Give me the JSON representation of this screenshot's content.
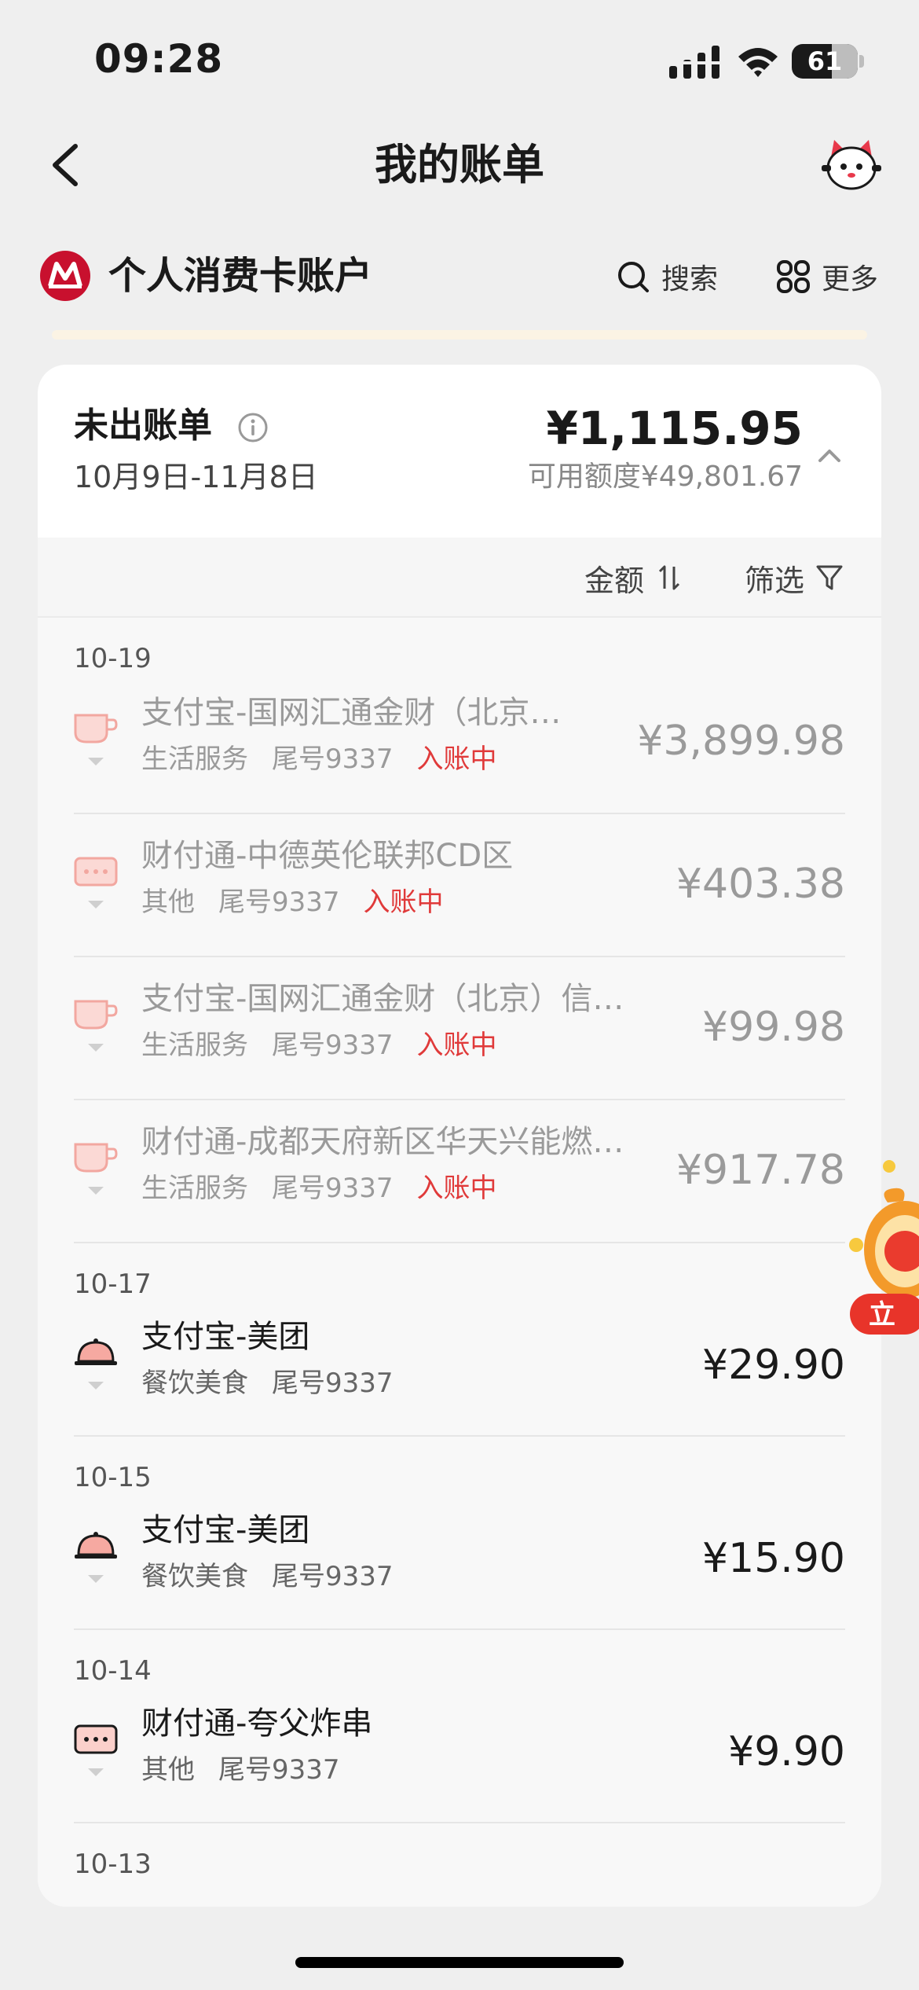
{
  "status_bar": {
    "time": "09:28",
    "battery": "61",
    "battery_level": 0.61,
    "icons": [
      "signal-icon",
      "wifi-icon",
      "battery-icon"
    ]
  },
  "nav": {
    "title": "我的账单",
    "back_icon": "chevron-left-icon",
    "mascot_icon": "cat-mascot-icon"
  },
  "account": {
    "title": "个人消费卡账户",
    "search_label": "搜索",
    "more_label": "更多",
    "brand_color": "#c8102e"
  },
  "bill_summary": {
    "label": "未出账单",
    "period": "10月9日-11月8日",
    "amount": "¥1,115.95",
    "available_credit": "可用额度¥49,801.67"
  },
  "toolbar": {
    "sort_label": "金额",
    "filter_label": "筛选"
  },
  "dates": [
    "10-19",
    "10-17",
    "10-15",
    "10-14",
    "10-13"
  ],
  "transactions": [
    {
      "merchant": "支付宝-国网汇通金财（北京…",
      "category": "生活服务",
      "card": "尾号9337",
      "status": "入账中",
      "amount": "¥3,899.98",
      "icon": "cup-icon"
    },
    {
      "merchant": "财付通-中德英伦联邦CD区",
      "category": "其他",
      "card": "尾号9337",
      "status": "入账中",
      "amount": "¥403.38",
      "icon": "message-dots-icon"
    },
    {
      "merchant": "支付宝-国网汇通金财（北京）信…",
      "category": "生活服务",
      "card": "尾号9337",
      "status": "入账中",
      "amount": "¥99.98",
      "icon": "cup-icon"
    },
    {
      "merchant": "财付通-成都天府新区华天兴能燃…",
      "category": "生活服务",
      "card": "尾号9337",
      "status": "入账中",
      "amount": "¥917.78",
      "icon": "cup-icon"
    },
    {
      "merchant": "支付宝-美团",
      "category": "餐饮美食",
      "card": "尾号9337",
      "status": "",
      "amount": "¥29.90",
      "icon": "food-cloche-icon"
    },
    {
      "merchant": "支付宝-美团",
      "category": "餐饮美食",
      "card": "尾号9337",
      "status": "",
      "amount": "¥15.90",
      "icon": "food-cloche-icon"
    },
    {
      "merchant": "财付通-夸父炸串",
      "category": "其他",
      "card": "尾号9337",
      "status": "",
      "amount": "¥9.90",
      "icon": "message-dots-icon"
    }
  ],
  "promo": {
    "text": "立"
  },
  "colors": {
    "accent_red": "#e03a3a",
    "icon_pink": "#f2a7a0"
  }
}
